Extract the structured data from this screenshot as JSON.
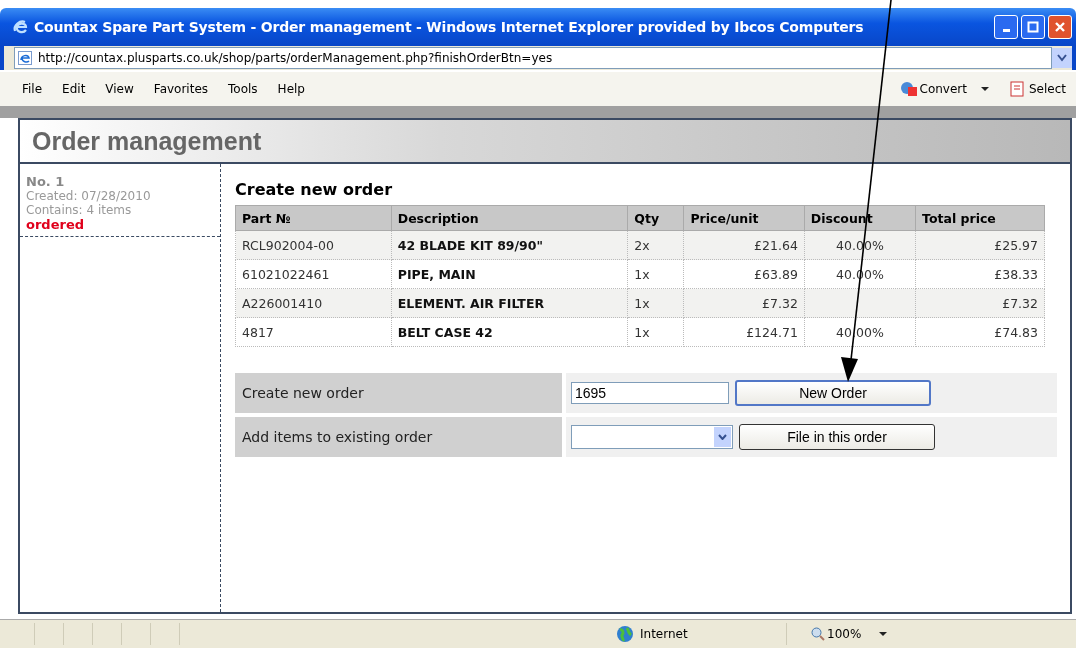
{
  "window": {
    "title": "Countax Spare Part System - Order management - Windows Internet Explorer provided by Ibcos Computers"
  },
  "address_bar": {
    "url": "http://countax.plusparts.co.uk/shop/parts/orderManagement.php?finishOrderBtn=yes"
  },
  "menu": [
    "File",
    "Edit",
    "View",
    "Favorites",
    "Tools",
    "Help"
  ],
  "toolbar": [
    {
      "label": "Convert",
      "kind": "convert"
    },
    {
      "label": "Select",
      "kind": "select"
    }
  ],
  "page": {
    "title": "Order management"
  },
  "sidebar": {
    "orders": [
      {
        "number": "No. 1",
        "created": "Created: 07/28/2010",
        "contains": "Contains: 4 items",
        "status": "ordered"
      }
    ]
  },
  "section_title": "Create new order",
  "table": {
    "columns": [
      "Part №",
      "Description",
      "Qty",
      "Price/unit",
      "Discount",
      "Total price"
    ],
    "rows": [
      [
        "RCL902004-00",
        "42 BLADE KIT 89/90\"",
        "2x",
        "£21.64",
        "40.00%",
        "£25.97"
      ],
      [
        "61021022461",
        "PIPE, MAIN",
        "1x",
        "£63.89",
        "40.00%",
        "£38.33"
      ],
      [
        "A226001410",
        "ELEMENT. AIR FILTER",
        "1x",
        "£7.32",
        "",
        "£7.32"
      ],
      [
        "4817",
        "BELT CASE 42",
        "1x",
        "£124.71",
        "40.00%",
        "£74.83"
      ]
    ]
  },
  "form": [
    {
      "label": "Create new order",
      "kind": "text",
      "value": "1695",
      "button": "New Order",
      "focused": true
    },
    {
      "label": "Add items to existing order",
      "kind": "select",
      "button": "File in this order",
      "focused": false
    }
  ],
  "status_bar": {
    "zone": "Internet",
    "zoom": "100%"
  }
}
